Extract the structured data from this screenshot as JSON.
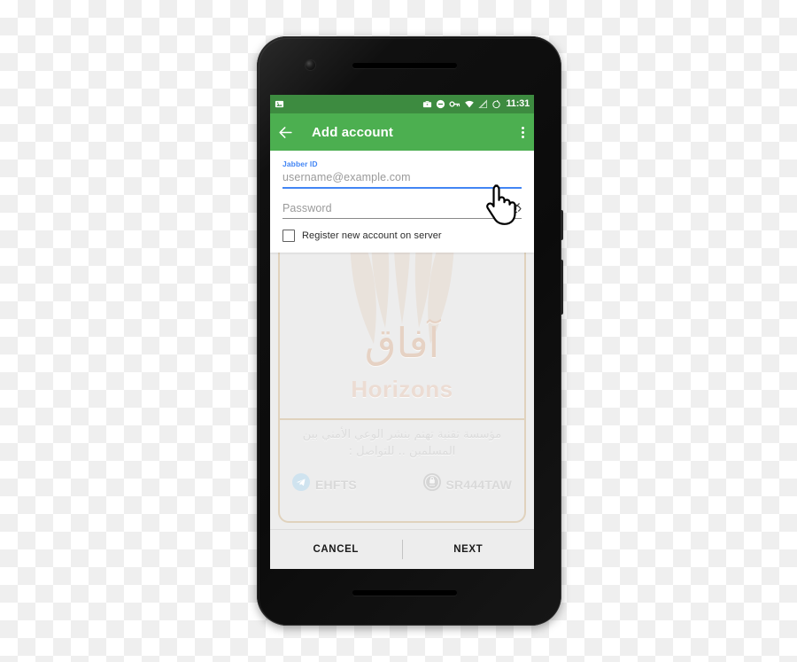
{
  "status_bar": {
    "notification_icon": "image-icon",
    "icons": [
      "work-profile-icon",
      "do-not-disturb-icon",
      "vpn-key-icon",
      "wifi-icon",
      "cell-signal-icon",
      "alarm-icon"
    ],
    "clock": "11:31"
  },
  "app_bar": {
    "back_icon": "back-arrow-icon",
    "title": "Add account",
    "overflow_icon": "overflow-menu-icon"
  },
  "form": {
    "jabber_id": {
      "label": "Jabber ID",
      "value": "",
      "placeholder": "username@example.com"
    },
    "password": {
      "label": "",
      "value": "",
      "placeholder": "Password",
      "toggle_icon": "eye-off-icon"
    },
    "register_checkbox": {
      "label": "Register new account on server",
      "checked": false
    }
  },
  "watermark": {
    "logo_arabic": "آفاق",
    "logo_latin": "Horizons",
    "caption": "مؤسسة تقنية تهتم بنشر الوعي الأمني بين المسلمين .. للتواصل :",
    "handles": [
      {
        "icon": "telegram-icon",
        "text": "EHFTS"
      },
      {
        "icon": "app-badge-icon",
        "text": "SR444TAW"
      }
    ]
  },
  "buttons": {
    "cancel": "CANCEL",
    "next": "NEXT"
  },
  "colors": {
    "status_bar_green": "#3d8b40",
    "app_bar_green": "#4caf50",
    "accent_blue": "#4285f4",
    "screen_background": "#ededed",
    "watermark_border": "#d6bc96"
  },
  "cursor": {
    "type": "pointing-hand-cursor"
  }
}
